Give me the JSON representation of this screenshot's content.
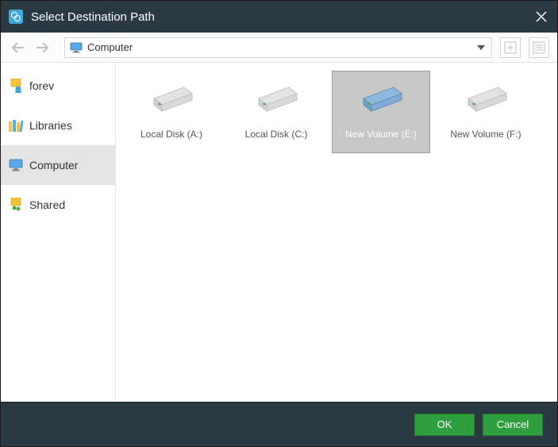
{
  "titlebar": {
    "title": "Select Destination Path"
  },
  "toolbar": {
    "path_label": "Computer"
  },
  "sidebar": {
    "items": [
      {
        "label": "forev",
        "name": "sidebar-item-forev"
      },
      {
        "label": "Libraries",
        "name": "sidebar-item-libraries"
      },
      {
        "label": "Computer",
        "name": "sidebar-item-computer"
      },
      {
        "label": "Shared",
        "name": "sidebar-item-shared"
      }
    ]
  },
  "drives": [
    {
      "label": "Local Disk (A:)",
      "name": "drive-a",
      "selected": false,
      "accent": "gray"
    },
    {
      "label": "Local Disk (C:)",
      "name": "drive-c",
      "selected": false,
      "accent": "gray"
    },
    {
      "label": "New Volume (E:)",
      "name": "drive-e",
      "selected": true,
      "accent": "blue"
    },
    {
      "label": "New Volume (F:)",
      "name": "drive-f",
      "selected": false,
      "accent": "gray"
    }
  ],
  "footer": {
    "ok_label": "OK",
    "cancel_label": "Cancel"
  }
}
